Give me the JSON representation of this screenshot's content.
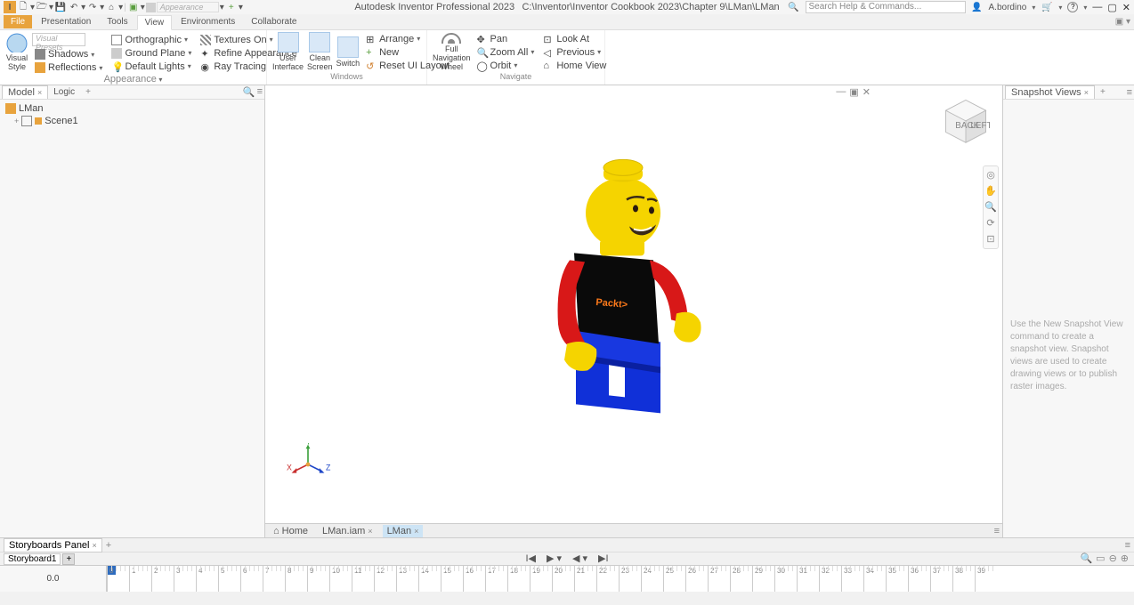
{
  "title_app": "Autodesk Inventor Professional 2023",
  "title_path": "C:\\Inventor\\Inventor Cookbook 2023\\Chapter 9\\LMan\\LMan",
  "appearance_label": "Appearance",
  "search_placeholder": "Search Help & Commands...",
  "user": "A.bordino",
  "tabs": {
    "file": "File",
    "presentation": "Presentation",
    "tools": "Tools",
    "view": "View",
    "environments": "Environments",
    "collaborate": "Collaborate"
  },
  "ribbon": {
    "appearance": {
      "visual_presets": "Visual Presets",
      "visual_style": "Visual Style",
      "shadows": "Shadows",
      "reflections": "Reflections",
      "orthographic": "Orthographic",
      "ground_plane": "Ground Plane",
      "default_lights": "Default Lights",
      "textures_on": "Textures On",
      "refine_appearance": "Refine Appearance",
      "ray_tracing": "Ray Tracing",
      "group": "Appearance"
    },
    "windows": {
      "user_interface": "User\nInterface",
      "clean_screen": "Clean\nScreen",
      "switch": "Switch",
      "arrange": "Arrange",
      "new": "New",
      "reset_ui": "Reset UI Layout",
      "group": "Windows"
    },
    "navigate": {
      "full_nav": "Full Navigation\nWheel",
      "pan": "Pan",
      "zoom_all": "Zoom All",
      "orbit": "Orbit",
      "look_at": "Look At",
      "previous": "Previous",
      "home_view": "Home View",
      "group": "Navigate"
    }
  },
  "model_panel": {
    "model": "Model",
    "logic": "Logic",
    "root": "LMan",
    "scene": "Scene1"
  },
  "viewcube": {
    "back": "BACK",
    "left": "LEFT"
  },
  "axes": {
    "x": "X",
    "y": "Y",
    "z": "Z"
  },
  "doc_tabs": {
    "home": "Home",
    "iam": "LMan.iam",
    "lman": "LMan"
  },
  "snapshot": {
    "title": "Snapshot Views",
    "text": "Use the New Snapshot View command to create a snapshot view. Snapshot views are used to create drawing views or to publish raster images."
  },
  "storyboard": {
    "panel": "Storyboards Panel",
    "sb1": "Storyboard1",
    "time": "0.0"
  },
  "ruler_ticks": [
    "0",
    "1",
    "2",
    "3",
    "4",
    "5",
    "6",
    "7",
    "8",
    "9",
    "10",
    "11",
    "12",
    "13",
    "14",
    "15",
    "16",
    "17",
    "18",
    "19",
    "20",
    "21",
    "22",
    "23",
    "24",
    "25",
    "26",
    "27",
    "28",
    "29",
    "30",
    "31",
    "32",
    "33",
    "34",
    "35",
    "36",
    "37",
    "38",
    "39"
  ],
  "lego_text": "Packt>"
}
